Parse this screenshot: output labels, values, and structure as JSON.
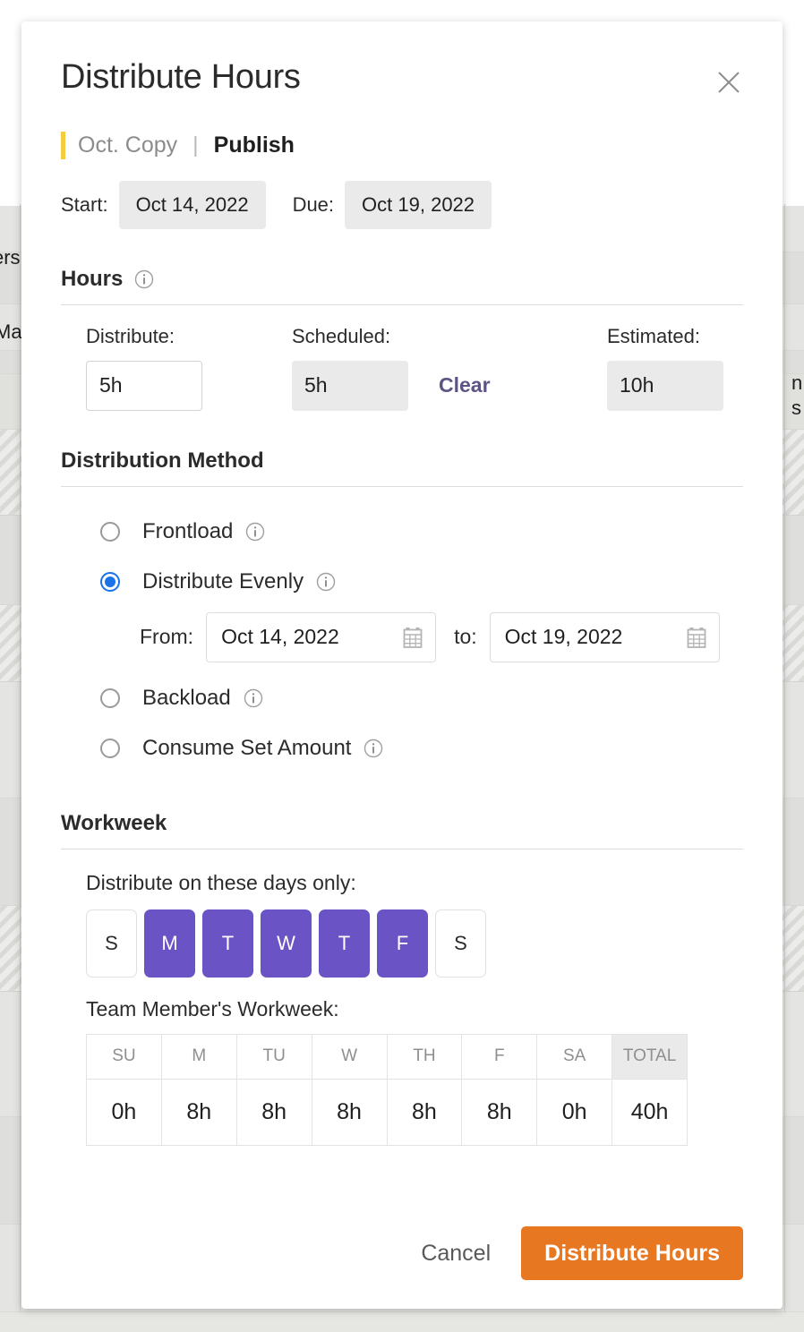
{
  "modal": {
    "title": "Distribute Hours",
    "close_icon": "close-icon",
    "breadcrumb": {
      "parent": "Oct. Copy",
      "separator": "|",
      "current": "Publish",
      "accent_color": "#f2ce3f"
    },
    "dates": {
      "start_label": "Start:",
      "start_value": "Oct 14, 2022",
      "due_label": "Due:",
      "due_value": "Oct 19, 2022"
    },
    "hours": {
      "section_title": "Hours",
      "info_icon": "info-icon",
      "distribute_label": "Distribute:",
      "distribute_value": "5h",
      "scheduled_label": "Scheduled:",
      "scheduled_value": "5h",
      "clear_label": "Clear",
      "clear_color": "#5d5384",
      "estimated_label": "Estimated:",
      "estimated_value": "10h"
    },
    "distribution_method": {
      "section_title": "Distribution Method",
      "selected": "distribute-evenly",
      "selected_color": "#1a73e8",
      "options": [
        {
          "id": "frontload",
          "label": "Frontload",
          "selected": false
        },
        {
          "id": "distribute-evenly",
          "label": "Distribute Evenly",
          "selected": true
        },
        {
          "id": "backload",
          "label": "Backload",
          "selected": false
        },
        {
          "id": "consume-set-amount",
          "label": "Consume Set Amount",
          "selected": false
        }
      ],
      "range": {
        "from_label": "From:",
        "from_value": "Oct 14, 2022",
        "to_label": "to:",
        "to_value": "Oct 19, 2022",
        "calendar_icon": "calendar-icon"
      }
    },
    "workweek": {
      "section_title": "Workweek",
      "days_prompt": "Distribute on these days only:",
      "active_color": "#6a53c4",
      "days": [
        {
          "letter": "S",
          "on": false
        },
        {
          "letter": "M",
          "on": true
        },
        {
          "letter": "T",
          "on": true
        },
        {
          "letter": "W",
          "on": true
        },
        {
          "letter": "T",
          "on": true
        },
        {
          "letter": "F",
          "on": true
        },
        {
          "letter": "S",
          "on": false
        }
      ],
      "table_prompt": "Team Member's Workweek:",
      "table": {
        "headers": [
          "SU",
          "M",
          "TU",
          "W",
          "TH",
          "F",
          "SA",
          "TOTAL"
        ],
        "values": [
          "0h",
          "8h",
          "8h",
          "8h",
          "8h",
          "8h",
          "0h",
          "40h"
        ]
      }
    },
    "footer": {
      "cancel_label": "Cancel",
      "submit_label": "Distribute Hours",
      "submit_color": "#e87722"
    }
  },
  "background": {
    "text_fragments": [
      "ers",
      "Ma",
      "n",
      "s"
    ]
  }
}
